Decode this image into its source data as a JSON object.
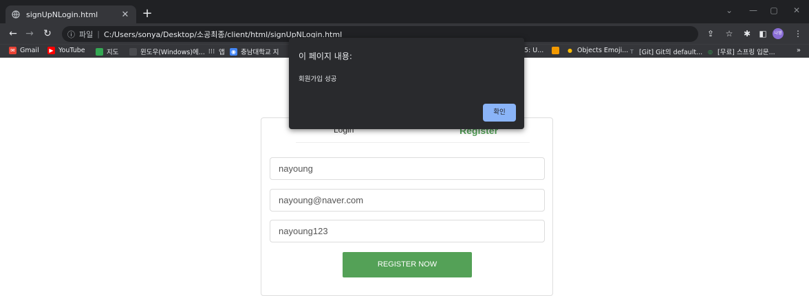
{
  "browser": {
    "tab": {
      "title": "signUpNLogin.html"
    },
    "address": {
      "scheme_label": "파일",
      "url": "C:/Users/sonya/Desktop/소공최종/client/html/signUpNLogin.html"
    },
    "profile_label": "나영"
  },
  "bookmarks": [
    {
      "label": "Gmail",
      "icon": "gmail-icon",
      "color": "#ea4335"
    },
    {
      "label": "YouTube",
      "icon": "youtube-icon",
      "color": "#ff0000"
    },
    {
      "label": "지도",
      "icon": "maps-icon",
      "color": "#34a853"
    },
    {
      "label": "윈도우(Windows)에...",
      "icon": "blank-icon",
      "color": "#5f6368"
    },
    {
      "label": "앱",
      "icon": "apps-grid-icon",
      "color": "#e8eaed"
    },
    {
      "label": "충남대학교 지",
      "icon": "cnu-icon",
      "color": "#4285f4"
    },
    {
      "label": "5: U...",
      "icon": "page-icon",
      "color": "#5f6368"
    },
    {
      "label": "",
      "icon": "orange-page-icon",
      "color": "#f29900"
    },
    {
      "label": "Objects Emoji...",
      "icon": "emoji-icon",
      "color": "#fbbc04"
    },
    {
      "label": "[Git] Git의 default...",
      "icon": "git-icon",
      "color": "#5f6368"
    },
    {
      "label": "[무료] 스프링 입문...",
      "icon": "inflearn-icon",
      "color": "#34a853"
    }
  ],
  "dialog": {
    "title": "이 페이지 내용:",
    "message": "회원가입 성공",
    "ok_label": "확인"
  },
  "form": {
    "tabs": {
      "login": "Login",
      "register": "Register"
    },
    "username": "nayoung",
    "email": "nayoung@naver.com",
    "password": "nayoung123",
    "submit_label": "REGISTER NOW"
  },
  "colors": {
    "accent": "#54a157",
    "dialog_button": "#8ab4f8",
    "chrome_dark": "#202124"
  }
}
